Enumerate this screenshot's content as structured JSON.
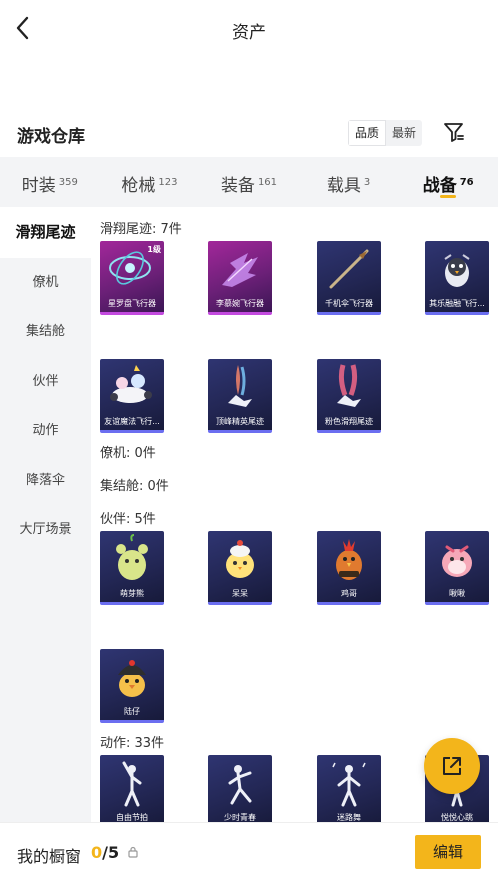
{
  "header": {
    "title": "资产",
    "back_icon": "chevron-left-icon"
  },
  "warehouse": {
    "title": "游戏仓库",
    "sort_options": [
      "品质",
      "最新"
    ],
    "sort_selected": "品质",
    "filter_icon": "filter-icon"
  },
  "categories": [
    {
      "label": "时装",
      "count": "359"
    },
    {
      "label": "枪械",
      "count": "123"
    },
    {
      "label": "装备",
      "count": "161"
    },
    {
      "label": "载具",
      "count": "3"
    },
    {
      "label": "战备",
      "count": "76",
      "active": true
    }
  ],
  "sidebar": {
    "items": [
      "滑翔尾迹",
      "僚机",
      "集结舱",
      "伙伴",
      "动作",
      "降落伞",
      "大厅场景"
    ],
    "active": "滑翔尾迹"
  },
  "sections": {
    "trail": {
      "title": "滑翔尾迹: 7件",
      "items": [
        {
          "name": "星罗盘飞行器",
          "grade": "1级",
          "rarity": "purple",
          "icon": "astrolabe-icon"
        },
        {
          "name": "李慕婉飞行器",
          "rarity": "purple",
          "icon": "crystal-wing-icon"
        },
        {
          "name": "千机伞飞行器",
          "rarity": "navy",
          "icon": "umbrella-staff-icon"
        },
        {
          "name": "其乐融融飞行...",
          "rarity": "navy",
          "icon": "penguin-balloon-icon"
        },
        {
          "name": "友谊魔法飞行...",
          "rarity": "navy",
          "icon": "magic-carriage-icon"
        },
        {
          "name": "顶峰精英尾迹",
          "rarity": "navy",
          "icon": "elite-trail-icon"
        },
        {
          "name": "粉色滑翔尾迹",
          "rarity": "navy",
          "icon": "pink-trail-icon"
        }
      ]
    },
    "wingman": {
      "title": "僚机: 0件"
    },
    "pod": {
      "title": "集结舱: 0件"
    },
    "partner": {
      "title": "伙伴: 5件",
      "items": [
        {
          "name": "萌芽熊",
          "rarity": "navy",
          "icon": "sprout-bear-icon"
        },
        {
          "name": "呆呆",
          "rarity": "navy",
          "icon": "chick-icon"
        },
        {
          "name": "鸡哥",
          "rarity": "navy",
          "icon": "rooster-icon"
        },
        {
          "name": "啾啾",
          "rarity": "navy",
          "icon": "pink-bird-icon"
        },
        {
          "name": "陆仔",
          "rarity": "navy",
          "icon": "helmet-duck-icon"
        }
      ]
    },
    "emote": {
      "title": "动作: 33件",
      "items": [
        {
          "name": "自由节拍",
          "rarity": "navy",
          "icon": "dance-pose-icon"
        },
        {
          "name": "少时青春",
          "rarity": "navy",
          "icon": "dance-pose-icon"
        },
        {
          "name": "迷路舞",
          "rarity": "navy",
          "icon": "dance-pose-icon"
        },
        {
          "name": "悦悦心跳",
          "rarity": "navy",
          "icon": "dance-pose-icon"
        }
      ]
    }
  },
  "showcase": {
    "label": "我的橱窗",
    "current": "0",
    "total": "/5",
    "lock_icon": "lock-icon"
  },
  "edit_label": "编辑",
  "share_icon": "share-external-icon",
  "colors": {
    "accent": "#f3b51b",
    "purple_rarity": "#a2279a",
    "navy_rarity": "#2f3572",
    "panel_bg": "#f3f4f6"
  }
}
